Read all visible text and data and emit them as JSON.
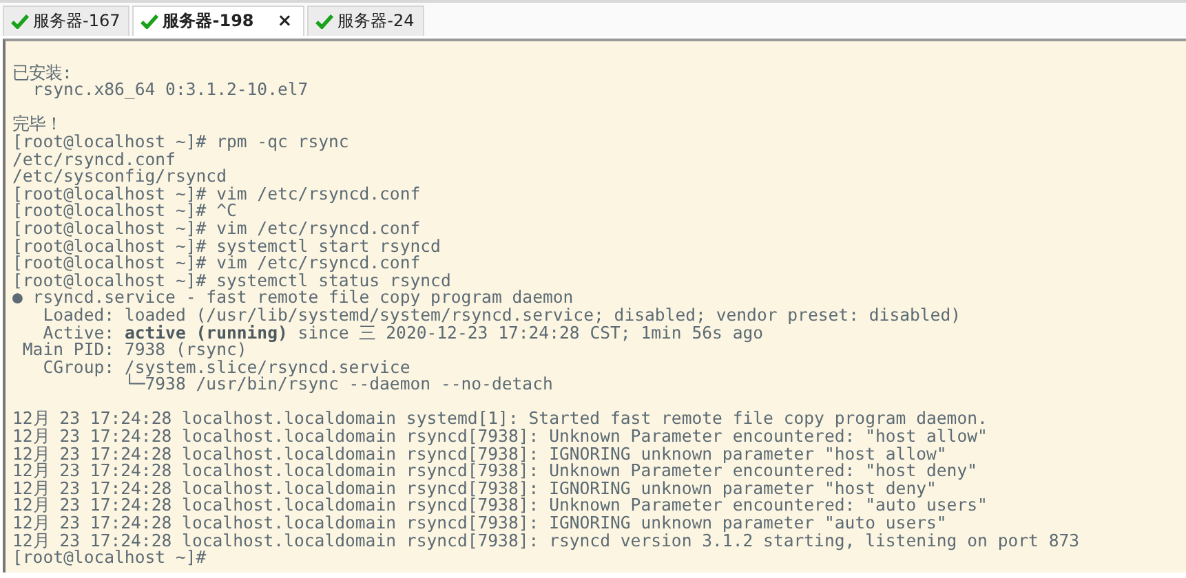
{
  "tabs": [
    {
      "label": "服务器-167",
      "selected": false
    },
    {
      "label": "服务器-198",
      "selected": true,
      "close": "×"
    },
    {
      "label": "服务器-24",
      "selected": false
    }
  ],
  "terminal": {
    "lines": [
      {
        "kind": "blank"
      },
      {
        "kind": "text",
        "text": "已安装:"
      },
      {
        "kind": "text",
        "text": "  rsync.x86_64 0:3.1.2-10.el7"
      },
      {
        "kind": "blank"
      },
      {
        "kind": "text",
        "text": "完毕！"
      },
      {
        "kind": "text",
        "text": "[root@localhost ~]# rpm -qc rsync"
      },
      {
        "kind": "text",
        "text": "/etc/rsyncd.conf"
      },
      {
        "kind": "text",
        "text": "/etc/sysconfig/rsyncd"
      },
      {
        "kind": "text",
        "text": "[root@localhost ~]# vim /etc/rsyncd.conf"
      },
      {
        "kind": "text",
        "text": "[root@localhost ~]# ^C"
      },
      {
        "kind": "text",
        "text": "[root@localhost ~]# vim /etc/rsyncd.conf"
      },
      {
        "kind": "text",
        "text": "[root@localhost ~]# systemctl start rsyncd"
      },
      {
        "kind": "text",
        "text": "[root@localhost ~]# vim /etc/rsyncd.conf"
      },
      {
        "kind": "text",
        "text": "[root@localhost ~]# systemctl status rsyncd"
      },
      {
        "kind": "text",
        "text": "● rsyncd.service - fast remote file copy program daemon"
      },
      {
        "kind": "text",
        "text": "   Loaded: loaded (/usr/lib/systemd/system/rsyncd.service; disabled; vendor preset: disabled)"
      },
      {
        "kind": "text",
        "text": "   Active: **active (running)** since 三 2020-12-23 17:24:28 CST; 1min 56s ago"
      },
      {
        "kind": "text",
        "text": " Main PID: 7938 (rsync)"
      },
      {
        "kind": "text",
        "text": "   CGroup: /system.slice/rsyncd.service"
      },
      {
        "kind": "text",
        "text": "           └─7938 /usr/bin/rsync --daemon --no-detach"
      },
      {
        "kind": "blank"
      },
      {
        "kind": "text",
        "text": "12月 23 17:24:28 localhost.localdomain systemd[1]: Started fast remote file copy program daemon."
      },
      {
        "kind": "text",
        "text": "12月 23 17:24:28 localhost.localdomain rsyncd[7938]: Unknown Parameter encountered: \"host allow\""
      },
      {
        "kind": "text",
        "text": "12月 23 17:24:28 localhost.localdomain rsyncd[7938]: IGNORING unknown parameter \"host allow\""
      },
      {
        "kind": "text",
        "text": "12月 23 17:24:28 localhost.localdomain rsyncd[7938]: Unknown Parameter encountered: \"host deny\""
      },
      {
        "kind": "text",
        "text": "12月 23 17:24:28 localhost.localdomain rsyncd[7938]: IGNORING unknown parameter \"host deny\""
      },
      {
        "kind": "text",
        "text": "12月 23 17:24:28 localhost.localdomain rsyncd[7938]: Unknown Parameter encountered: \"auto users\""
      },
      {
        "kind": "text",
        "text": "12月 23 17:24:28 localhost.localdomain rsyncd[7938]: IGNORING unknown parameter \"auto users\""
      },
      {
        "kind": "text",
        "text": "12月 23 17:24:28 localhost.localdomain rsyncd[7938]: rsyncd version 3.1.2 starting, listening on port 873"
      },
      {
        "kind": "text",
        "text": "[root@localhost ~]# "
      }
    ]
  }
}
